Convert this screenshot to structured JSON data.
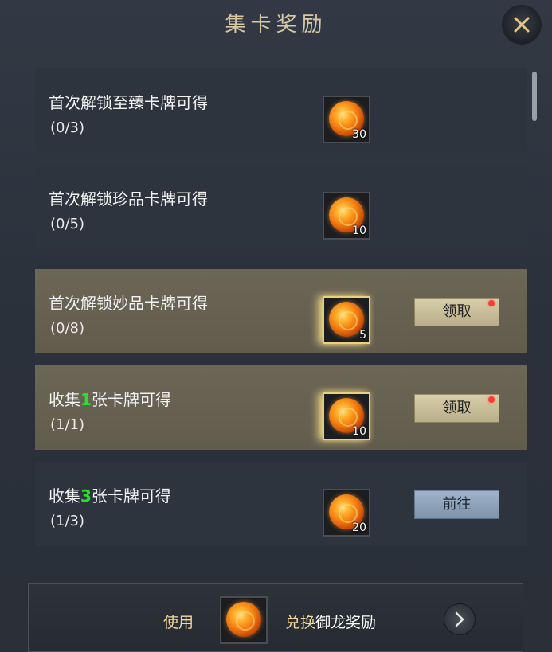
{
  "title": "集卡奖励",
  "rows": [
    {
      "desc_pre": "首次解锁至臻卡牌可得",
      "desc_num": "",
      "desc_post": "",
      "progress": "(0/3)",
      "qty": "30",
      "button": ""
    },
    {
      "desc_pre": "首次解锁珍品卡牌可得",
      "desc_num": "",
      "desc_post": "",
      "progress": "(0/5)",
      "qty": "10",
      "button": ""
    },
    {
      "desc_pre": "首次解锁妙品卡牌可得",
      "desc_num": "",
      "desc_post": "",
      "progress": "(0/8)",
      "qty": "5",
      "button": "领取"
    },
    {
      "desc_pre": "收集",
      "desc_num": "1",
      "desc_post": "张卡牌可得",
      "progress": "(1/1)",
      "qty": "10",
      "button": "领取"
    },
    {
      "desc_pre": "收集",
      "desc_num": "3",
      "desc_post": "张卡牌可得",
      "progress": "(1/3)",
      "qty": "20",
      "button": "前往"
    }
  ],
  "bottom": {
    "use_label": "使用",
    "exchange_prefix": "兑换",
    "exchange_target": "御龙奖励"
  },
  "colors": {
    "highlight_row": "#6c6656",
    "claim_button": "#cfc49f",
    "goto_button": "#8fa5bc",
    "green_number": "#29e02c",
    "red_dot": "#ff3b30"
  }
}
